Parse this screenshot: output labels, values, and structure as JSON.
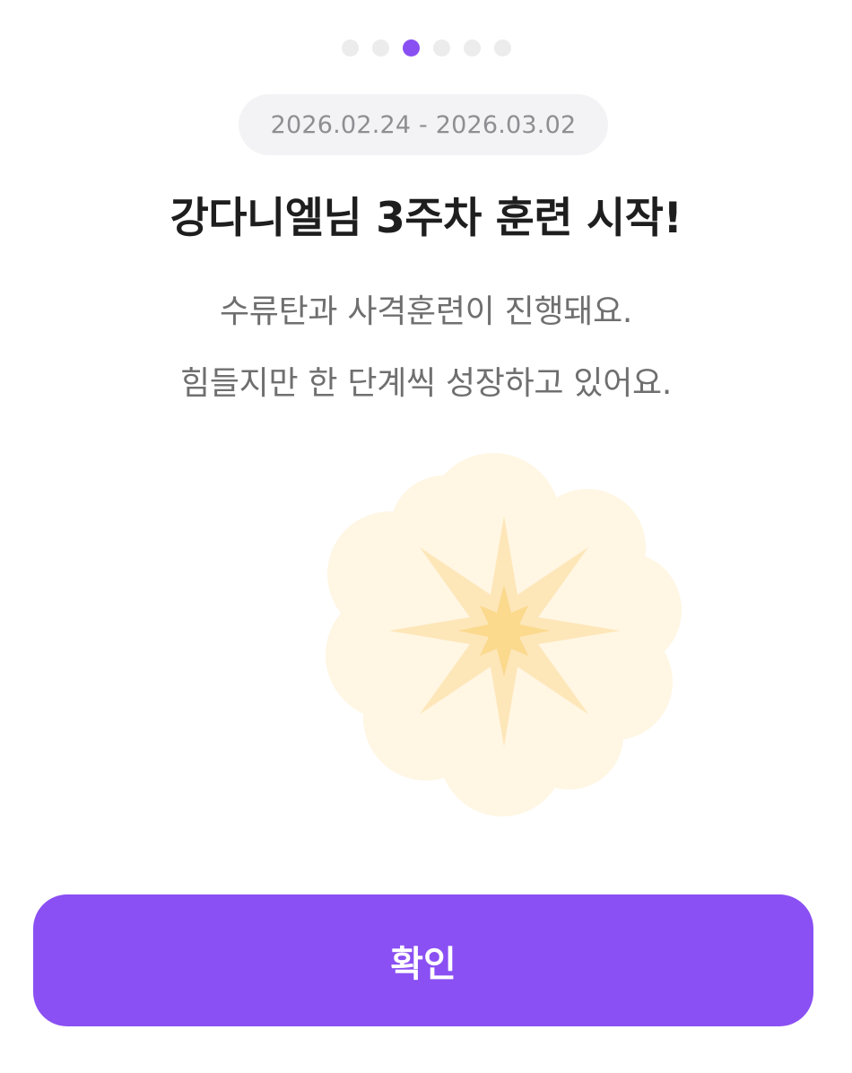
{
  "pagination": {
    "total": 6,
    "active_index": 2
  },
  "date_range": "2026.02.24 - 2026.03.02",
  "title": "강다니엘님 3주차 훈련 시작!",
  "description": {
    "line1": "수류탄과 사격훈련이 진행돼요.",
    "line2": "힘들지만 한 단계씩 성장하고 있어요."
  },
  "illustration": {
    "icon": "sparkle-burst-icon",
    "colors": {
      "cloud": "#fff6e3",
      "outer_star": "#fde6b8",
      "inner_star": "#fbd98d"
    }
  },
  "confirm_button": {
    "label": "확인"
  },
  "colors": {
    "accent": "#8a50f3",
    "dot_inactive": "#ececec"
  }
}
